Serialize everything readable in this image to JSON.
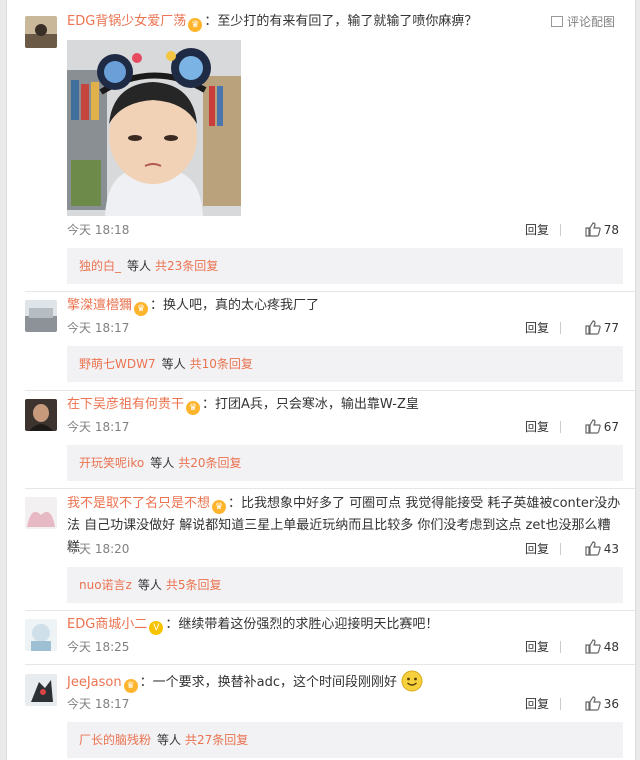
{
  "comments": [
    {
      "user": "EDG背锅少女爱厂荡",
      "badge": "♛",
      "text": "至少打的有来有回了，输了就输了喷你麻痹？",
      "tool": "评论配图",
      "time": "今天 18:18",
      "reply": "回复",
      "likes": "78",
      "sub_user": "独的白_",
      "sub_mid": "等人",
      "sub_count": "共23条回复"
    },
    {
      "user": "擎滐邅櫿獮",
      "badge": "♛",
      "text": "换人吧，真的太心疼我厂了",
      "time": "今天 18:17",
      "reply": "回复",
      "likes": "77",
      "sub_user": "野萌七WDW7",
      "sub_mid": "等人",
      "sub_count": "共10条回复"
    },
    {
      "user": "在下吴彦祖有何贵干",
      "badge": "♛",
      "text": "打团A兵，只会寒冰，输出靠W-Z皇",
      "time": "今天 18:17",
      "reply": "回复",
      "likes": "67",
      "sub_user": "开玩笑呢iko",
      "sub_mid": "等人",
      "sub_count": "共20条回复"
    },
    {
      "user": "我不是取不了名只是不想",
      "badge": "♛",
      "text": "比我想象中好多了 可圈可点 我觉得能接受 耗子英雄被conter没办法 自己功课没做好 解说都知道三星上单最近玩纳而且比较多 你们没考虑到这点 zet也没那么糟糕",
      "time": "今天 18:20",
      "reply": "回复",
      "likes": "43",
      "sub_user": "nuo诺言z",
      "sub_mid": "等人",
      "sub_count": "共5条回复"
    },
    {
      "user": "EDG商城小二",
      "badge": "V",
      "text": "继续带着这份强烈的求胜心迎接明天比赛吧！",
      "time": "今天 18:25",
      "reply": "回复",
      "likes": "48"
    },
    {
      "user": "JeeJason",
      "badge": "♛",
      "text": "一个要求，换替补adc，这个时间段刚刚好",
      "time": "今天 18:17",
      "reply": "回复",
      "likes": "36",
      "sub_user": "厂长的脑残粉",
      "sub_mid": "等人",
      "sub_count": "共27条回复"
    }
  ],
  "icons": {
    "like": "thumbs-up-icon",
    "tool": "image-icon",
    "emoji": "smiley-icon"
  },
  "colors": {
    "username": "#eb7350",
    "meta": "#808080",
    "subbar": "#f2f2f5"
  }
}
